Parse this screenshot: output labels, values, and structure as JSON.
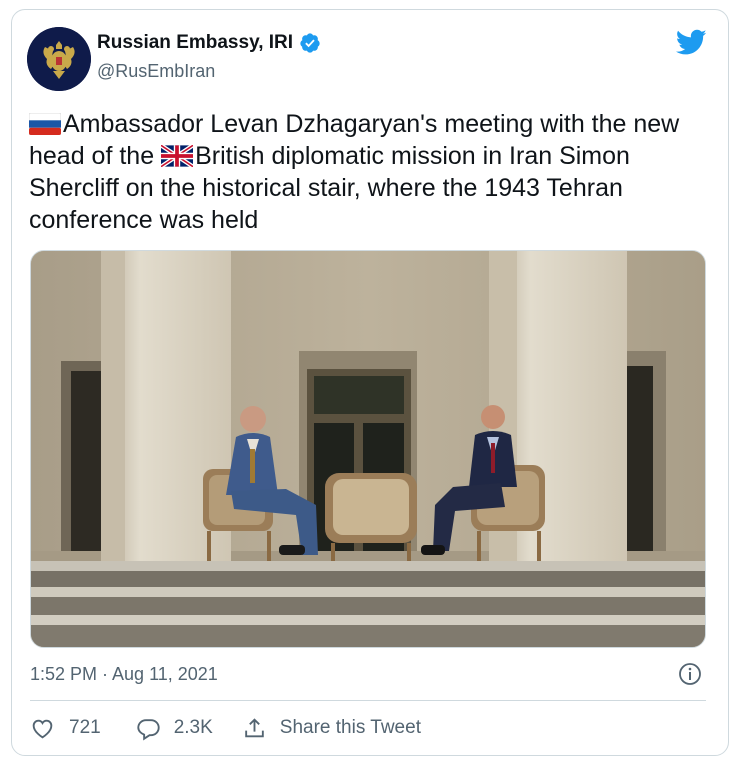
{
  "header": {
    "display_name": "Russian Embassy, IRI",
    "handle": "@RusEmbIran",
    "verified_icon": "verified-badge-icon",
    "platform_icon": "twitter-bird-icon"
  },
  "tweet": {
    "text_part1": "Ambassador Levan Dzhagaryan's meeting with the new head of the ",
    "text_part2": "British diplomatic mission in Iran Simon Shercliff on the historical stair, where the 1943 Tehran conference was held",
    "flag1": "russia-flag-icon",
    "flag2": "uk-flag-icon"
  },
  "timestamp": "1:52 PM · Aug 11, 2021",
  "actions": {
    "like_count": "721",
    "reply_count": "2.3K",
    "share_label": "Share this Tweet"
  },
  "colors": {
    "brand": "#1d9bf0",
    "text": "#0f1419",
    "secondary": "#536471",
    "border": "#cfd9de"
  }
}
